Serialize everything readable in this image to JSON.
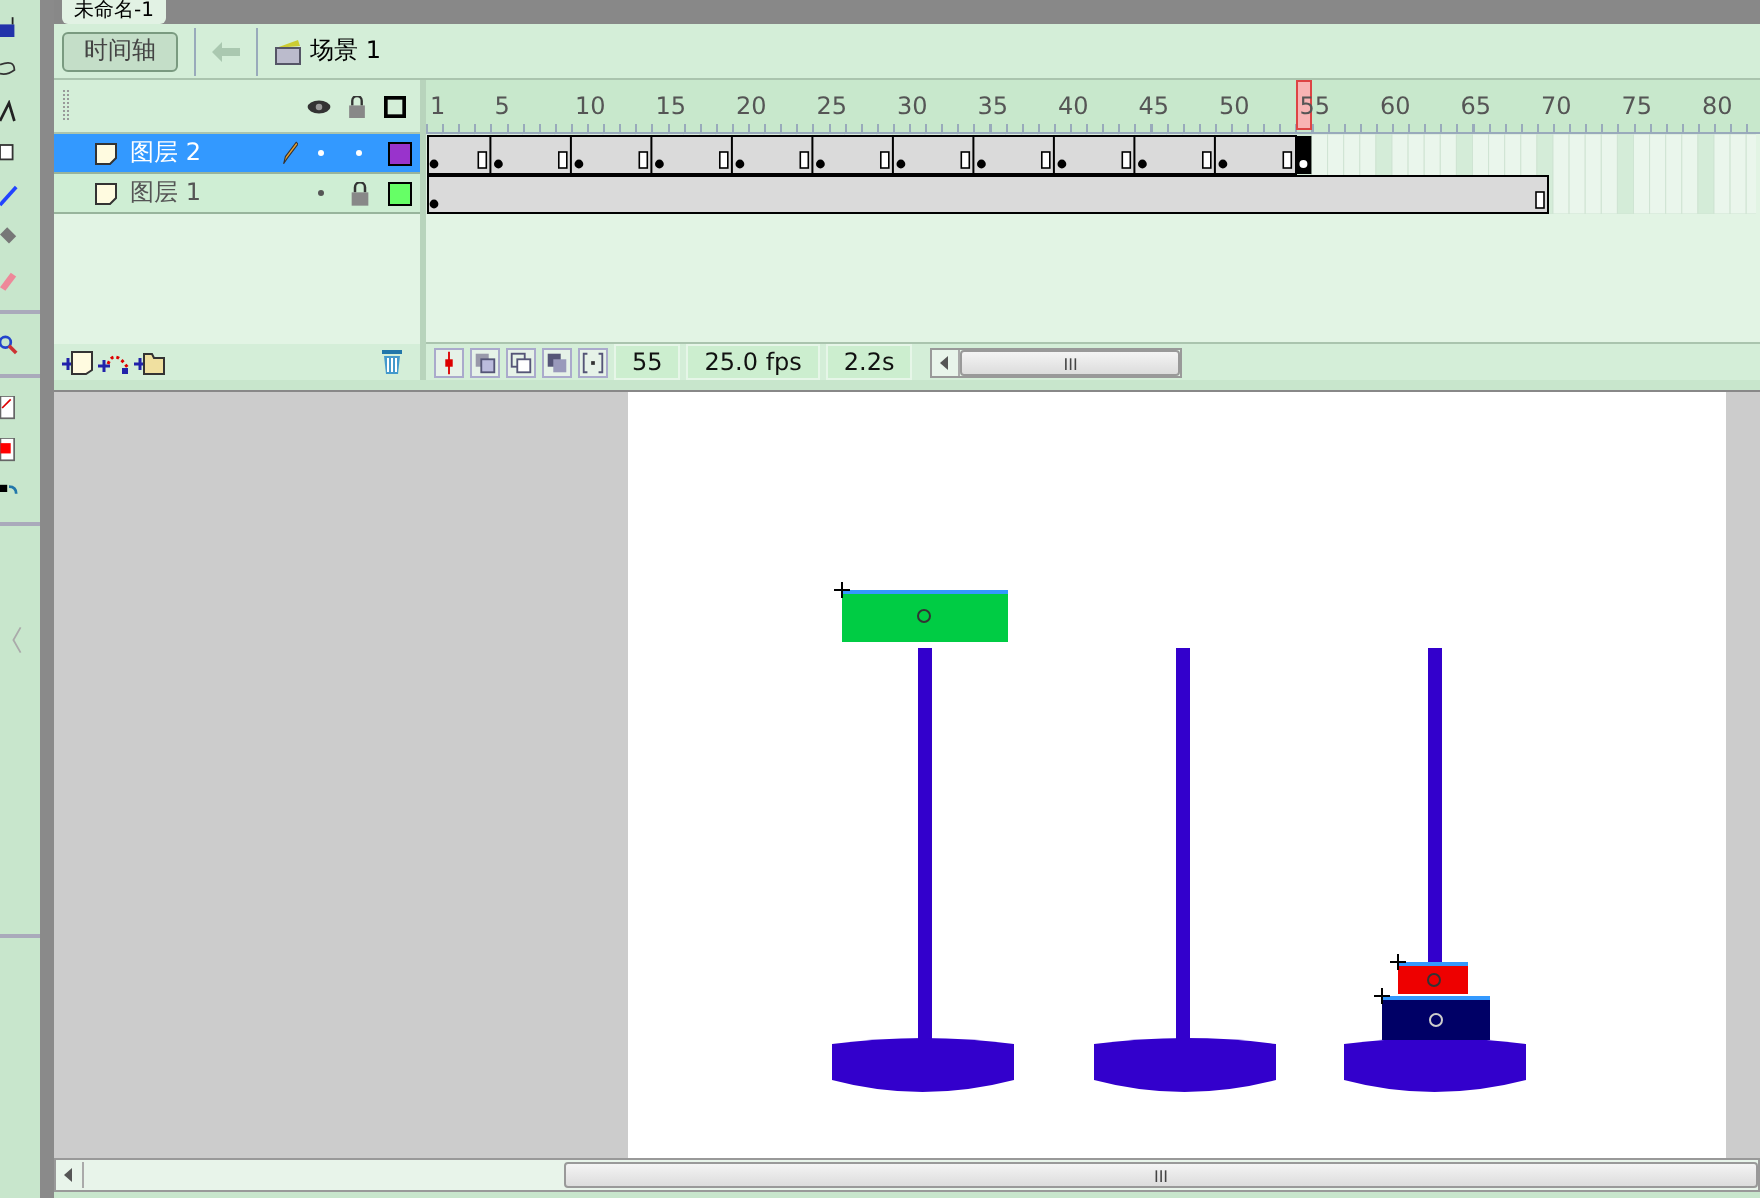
{
  "document_tab": {
    "title": "未命名-1"
  },
  "edit_bar": {
    "timeline_button": "时间轴",
    "scene": "场景 1"
  },
  "layers": [
    {
      "name": "图层 2",
      "selected": true,
      "locked": false,
      "color": "#9933cc"
    },
    {
      "name": "图层 1",
      "selected": false,
      "locked": true,
      "color": "#66ff66"
    }
  ],
  "ruler": [
    "1",
    "5",
    "10",
    "15",
    "20",
    "25",
    "30",
    "35",
    "40",
    "45",
    "50",
    "55",
    "60",
    "65",
    "70",
    "75",
    "80"
  ],
  "status": {
    "current_frame": "55",
    "frame_rate": "25.0 fps",
    "elapsed_time": "2.2s"
  },
  "scrollbar_grip": "III",
  "horizontal_scrollbar_grip": "III"
}
